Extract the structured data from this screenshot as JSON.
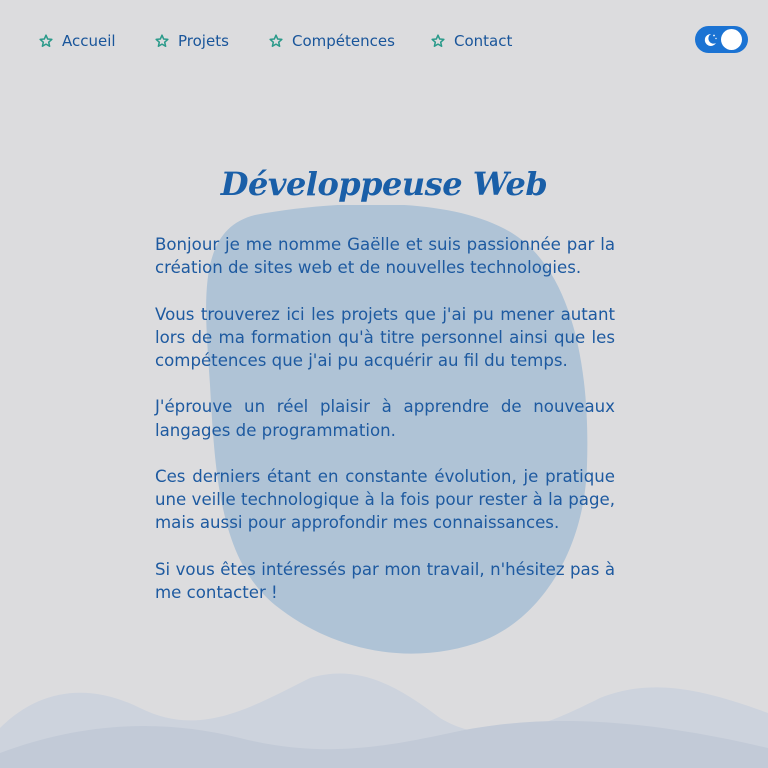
{
  "nav": {
    "items": [
      {
        "label": "Accueil",
        "icon": "star-icon"
      },
      {
        "label": "Projets",
        "icon": "star-icon"
      },
      {
        "label": "Compétences",
        "icon": "star-icon"
      },
      {
        "label": "Contact",
        "icon": "star-icon"
      }
    ],
    "theme_toggle": {
      "icon": "moon-icon",
      "state": "off"
    }
  },
  "main": {
    "title": "Développeuse Web",
    "paragraphs": [
      "Bonjour je me nomme Gaëlle et suis passionnée par la création de sites web et de nouvelles technologies.",
      "Vous trouverez ici les projets que j'ai pu mener autant lors de ma formation qu'à titre personnel ainsi que les compétences que j'ai pu acquérir au fil du temps.",
      "J'éprouve un réel plaisir à apprendre de nouveaux langages de programmation.",
      "Ces derniers étant en constante évolution, je pratique une veille technologique à la fois pour rester à la page, mais aussi pour approfondir mes connaissances.",
      "Si vous êtes intéressés par mon travail, n'hésitez pas à me contacter !"
    ]
  },
  "colors": {
    "background": "#dcdcde",
    "text": "#1e5aa0",
    "star": "#2a9a8a",
    "toggle": "#1b73d3",
    "blob": "#afc3d6",
    "waves": "#c3cbd8"
  }
}
